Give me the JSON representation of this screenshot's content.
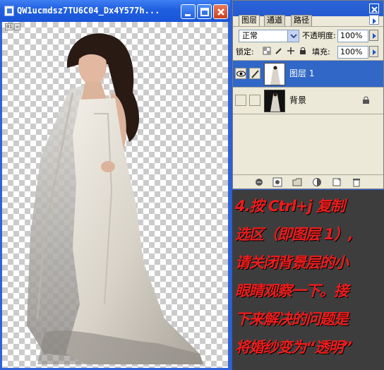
{
  "document_window": {
    "title": "QW1ucmdsz7TU6C04_Dx4Y577h...",
    "tiny_tabs": [
      "01",
      "✉"
    ],
    "buttons": [
      "minimize",
      "maximize",
      "close"
    ]
  },
  "layers_palette": {
    "tabs": [
      "图层",
      "通道",
      "路径"
    ],
    "blend_mode": "正常",
    "opacity_label": "不透明度:",
    "opacity_value": "100%",
    "lock_label": "锁定:",
    "fill_label": "填充:",
    "fill_value": "100%",
    "layers": [
      {
        "name": "图层 1",
        "selected": true,
        "visible": true
      },
      {
        "name": "背景",
        "selected": false,
        "visible": false,
        "locked": true
      }
    ],
    "bottom_icons": [
      "link-icon",
      "layer-style-icon",
      "mask-icon",
      "folder-icon",
      "adjustment-icon",
      "new-layer-icon",
      "trash-icon"
    ]
  },
  "annotation": {
    "color": "#ee1c1c",
    "lines": [
      "4.按 Ctrl+j 复制",
      "选区（即图层 1）,",
      "请关闭背景层的小",
      "眼睛观察一下。接",
      "下来解决的问题是",
      "将婚纱变为“透明”"
    ]
  }
}
